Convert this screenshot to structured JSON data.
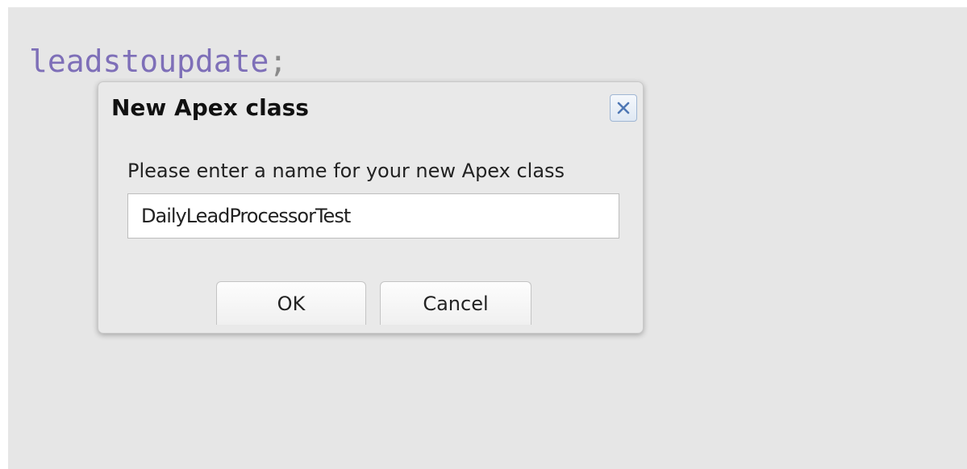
{
  "editor": {
    "code_identifier": "leadstoupdate",
    "code_punctuation": ";",
    "identifier_color": "#7e6fb8",
    "background_color": "#e6e6e6"
  },
  "dialog": {
    "title": "New Apex class",
    "close_icon": "close-x-icon",
    "prompt_label": "Please enter a name for your new Apex class",
    "class_name_value": "DailyLeadProcessorTest",
    "ok_label": "OK",
    "cancel_label": "Cancel"
  }
}
